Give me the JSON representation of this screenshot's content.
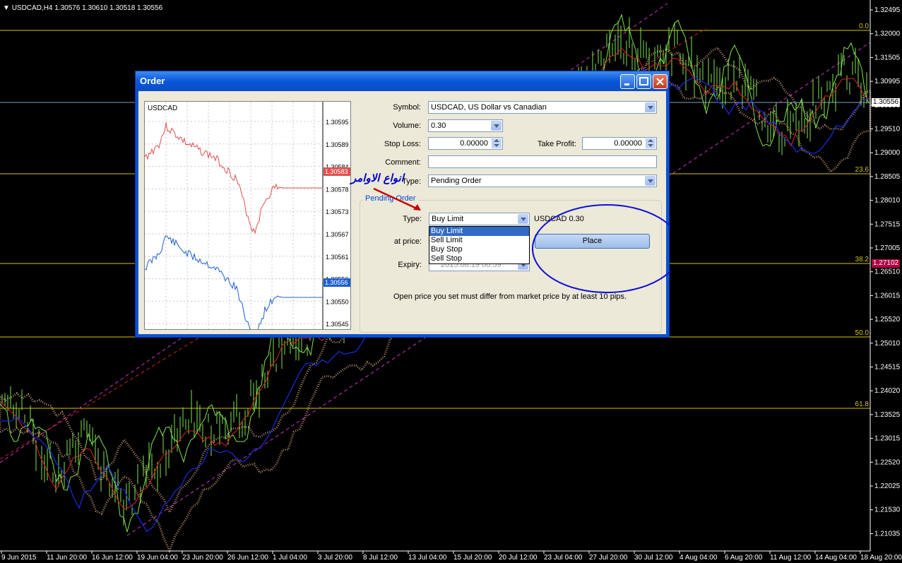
{
  "chart": {
    "header": "USDCAD,H4  1.30576  1.30610  1.30518  1.30556",
    "price_axis": [
      "1.32495",
      "1.32000",
      "1.31505",
      "1.30995",
      "1.30500",
      "1.29510",
      "1.29000",
      "1.28505",
      "1.28010",
      "1.27515",
      "1.27005",
      "1.26510",
      "1.26015",
      "1.25520",
      "1.25010",
      "1.24515",
      "1.24020",
      "1.23525",
      "1.23015",
      "1.22520",
      "1.22025",
      "1.21530",
      "1.21035"
    ],
    "time_axis": [
      "9 Jun 2015",
      "11 Jun 20:00",
      "16 Jun 12:00",
      "19 Jun 04:00",
      "23 Jun 20:00",
      "26 Jun 12:00",
      "1 Jul 04:00",
      "3 Jul 20:00",
      "8 Jul 12:00",
      "13 Jul 04:00",
      "15 Jul 20:00",
      "20 Jul 12:00",
      "23 Jul 04:00",
      "27 Jul 20:00",
      "30 Jul 12:00",
      "4 Aug 04:00",
      "6 Aug 20:00",
      "11 Aug 12:00",
      "14 Aug 04:00",
      "18 Aug 20:00"
    ],
    "fib_levels": [
      "0.0",
      "23.6",
      "38.2",
      "50.0",
      "61.8"
    ],
    "current_price_tag": "1.30556",
    "level_price_tag": "1.27102",
    "colors": {
      "bid_line": "#7fa0c0",
      "fib": "#d9c400",
      "candles": "#7fe34f",
      "tenkan": "#e02020",
      "kijun": "#1a2ce0",
      "cloud": "#e8b48a",
      "channel": "#cc33cc"
    }
  },
  "order": {
    "title": "Order",
    "mini_chart": {
      "symbol": "USDCAD",
      "axis": [
        "1.30595",
        "1.30589",
        "1.30584",
        "1.30578",
        "1.30573",
        "1.30567",
        "1.30561",
        "1.30556",
        "1.30550",
        "1.30545"
      ],
      "bid_tag": "1.30583",
      "ask_tag": "1.30556"
    },
    "symbol_label": "Symbol:",
    "symbol_value": "USDCAD, US Dollar vs Canadian",
    "volume_label": "Volume:",
    "volume_value": "0.30",
    "stop_loss_label": "Stop Loss:",
    "stop_loss_value": "0.00000",
    "take_profit_label": "Take Profit:",
    "take_profit_value": "0.00000",
    "comment_label": "Comment:",
    "comment_value": "",
    "type_label": "Type:",
    "type_value": "Pending Order",
    "pending": {
      "group_title": "Pending Order",
      "type_label": "Type:",
      "type_value": "Buy Limit",
      "info": "USDCAD 0.30",
      "options": [
        "Buy Limit",
        "Sell Limit",
        "Buy Stop",
        "Sell Stop"
      ],
      "price_label": "at price:",
      "expiry_label": "Expiry:",
      "expiry_value": "2015.08.19 00:59",
      "place_label": "Place",
      "note": "Open price you set must differ from market price by at least 10 pips."
    },
    "annotation": "انواع الاوامر",
    "colors": {
      "title": "#0a52d6",
      "dialog": "#ece9d8",
      "highlight": "#316ac5",
      "annotation": "#0000c8"
    }
  }
}
